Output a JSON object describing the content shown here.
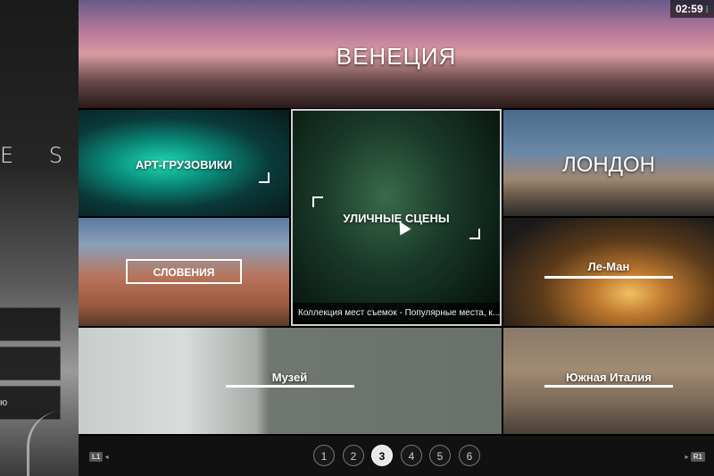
{
  "sidebar": {
    "brand": "E S",
    "menu": [
      "",
      "",
      "ю"
    ]
  },
  "status": {
    "time": "02:59",
    "signal_icon": "signal-icon"
  },
  "tiles": {
    "venice": "ВЕНЕЦИЯ",
    "trucks": "АРТ-ГРУЗОВИКИ",
    "slovenia": "СЛОВЕНИЯ",
    "street": "УЛИЧНЫЕ СЦЕНЫ",
    "street_caption": "Коллекция мест съемок - Популярные места, к...",
    "london": "ЛОНДОН",
    "lemans": "Ле-Ман",
    "museum": "Музей",
    "south_italy": "Южная Италия"
  },
  "pager": {
    "left_shoulder": "L1",
    "right_shoulder": "R1",
    "pages": [
      "1",
      "2",
      "3",
      "4",
      "5",
      "6"
    ],
    "current": "3"
  }
}
